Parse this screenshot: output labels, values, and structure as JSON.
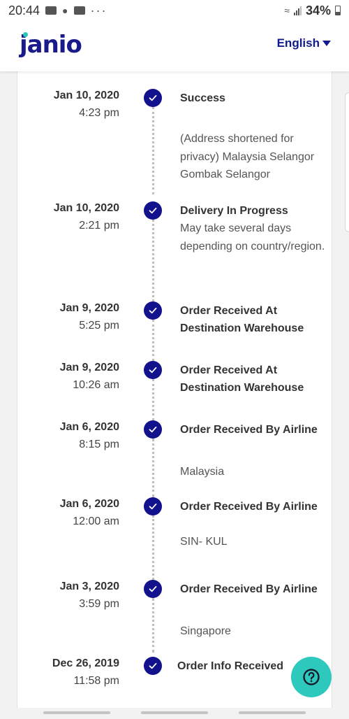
{
  "status_bar": {
    "time": "20:44",
    "battery": "34%",
    "left_icons": [
      "youtube-icon",
      "notification-icon",
      "youtube-icon"
    ],
    "more": "···"
  },
  "header": {
    "logo": "janio",
    "language": "English"
  },
  "colors": {
    "brand_navy": "#12128c",
    "accent_teal": "#2ec9bd"
  },
  "timeline": [
    {
      "date": "Jan 10, 2020",
      "time": "4:23 pm",
      "title": "Success",
      "detail": "(Address shortened for privacy) Malaysia Selangor Gombak Selangor"
    },
    {
      "date": "Jan 10, 2020",
      "time": "2:21 pm",
      "title": "Delivery In Progress",
      "detail": "May take several days depending on country/region."
    },
    {
      "date": "Jan 9, 2020",
      "time": "5:25 pm",
      "title": "Order Received At Destination Warehouse",
      "detail": ""
    },
    {
      "date": "Jan 9, 2020",
      "time": "10:26 am",
      "title": "Order Received At Destination Warehouse",
      "detail": ""
    },
    {
      "date": "Jan 6, 2020",
      "time": "8:15 pm",
      "title": "Order Received By Airline",
      "detail": "Malaysia"
    },
    {
      "date": "Jan 6, 2020",
      "time": "12:00 am",
      "title": "Order Received By Airline",
      "detail": "SIN- KUL"
    },
    {
      "date": "Jan 3, 2020",
      "time": "3:59 pm",
      "title": "Order Received By Airline",
      "detail": "Singapore"
    },
    {
      "date": "Dec 26, 2019",
      "time": "11:58 pm",
      "title": "Order Info Received",
      "detail": ""
    }
  ]
}
